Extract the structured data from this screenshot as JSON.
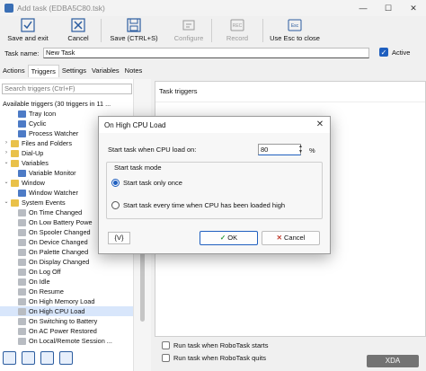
{
  "window": {
    "title": "Add task (EDBA5C80.tsk)"
  },
  "toolbar": {
    "save_exit": "Save and exit",
    "cancel": "Cancel",
    "save": "Save (CTRL+S)",
    "configure": "Configure",
    "record": "Record",
    "use_esc": "Use Esc to close"
  },
  "task": {
    "name_label": "Task name:",
    "name_value": "New Task",
    "active_label": "Active"
  },
  "tabs": [
    "Actions",
    "Triggers",
    "Settings",
    "Variables",
    "Notes"
  ],
  "left": {
    "search_placeholder": "Search triggers (Ctrl+F)",
    "tree": [
      {
        "label": "Available triggers (30 triggers in 11 ...",
        "level": 0
      },
      {
        "label": "Tray Icon",
        "level": 2,
        "icon": "blue"
      },
      {
        "label": "Cyclic",
        "level": 2,
        "icon": "blue"
      },
      {
        "label": "Process Watcher",
        "level": 2,
        "icon": "blue"
      },
      {
        "label": "Files and Folders",
        "level": 1,
        "icon": "folder",
        "exp": "›"
      },
      {
        "label": "Dial-Up",
        "level": 1,
        "icon": "folder",
        "exp": "›"
      },
      {
        "label": "Variables",
        "level": 1,
        "icon": "folder",
        "exp": "⌄"
      },
      {
        "label": "Variable Monitor",
        "level": 2,
        "icon": "blue"
      },
      {
        "label": "Window",
        "level": 1,
        "icon": "folder",
        "exp": "⌄"
      },
      {
        "label": "Window Watcher",
        "level": 2,
        "icon": "blue"
      },
      {
        "label": "System Events",
        "level": 1,
        "icon": "folder",
        "exp": "⌄"
      },
      {
        "label": "On Time Changed",
        "level": 2,
        "icon": "gray"
      },
      {
        "label": "On Low Battery Powe",
        "level": 2,
        "icon": "gray"
      },
      {
        "label": "On Spooler Changed",
        "level": 2,
        "icon": "gray"
      },
      {
        "label": "On Device Changed",
        "level": 2,
        "icon": "gray"
      },
      {
        "label": "On Palette Changed",
        "level": 2,
        "icon": "gray"
      },
      {
        "label": "On Display Changed",
        "level": 2,
        "icon": "gray"
      },
      {
        "label": "On Log Off",
        "level": 2,
        "icon": "gray"
      },
      {
        "label": "On Idle",
        "level": 2,
        "icon": "gray"
      },
      {
        "label": "On Resume",
        "level": 2,
        "icon": "gray"
      },
      {
        "label": "On High Memory Load",
        "level": 2,
        "icon": "gray"
      },
      {
        "label": "On High CPU Load",
        "level": 2,
        "icon": "gray",
        "selected": true
      },
      {
        "label": "On Switching to Battery",
        "level": 2,
        "icon": "gray"
      },
      {
        "label": "On AC Power Restored",
        "level": 2,
        "icon": "gray"
      },
      {
        "label": "On Local/Remote Session ...",
        "level": 2,
        "icon": "gray"
      }
    ]
  },
  "right": {
    "header": "Task triggers",
    "opt_start": "Run task when RoboTask starts",
    "opt_quit": "Run task when RoboTask quits"
  },
  "dialog": {
    "title": "On High CPU Load",
    "cpu_label": "Start task when CPU load on:",
    "cpu_value": "80",
    "pct": "%",
    "group_label": "Start task mode",
    "radio_once": "Start task only once",
    "radio_every": "Start task every time when CPU has been loaded high",
    "vars_btn": "{V}",
    "ok": "OK",
    "cancel": "Cancel"
  },
  "watermark": "XDA",
  "colors": {
    "accent": "#1f5fbf",
    "ok_check": "#2a9a3a",
    "cancel_x": "#c0392b",
    "selection": "#d8e6fb"
  }
}
